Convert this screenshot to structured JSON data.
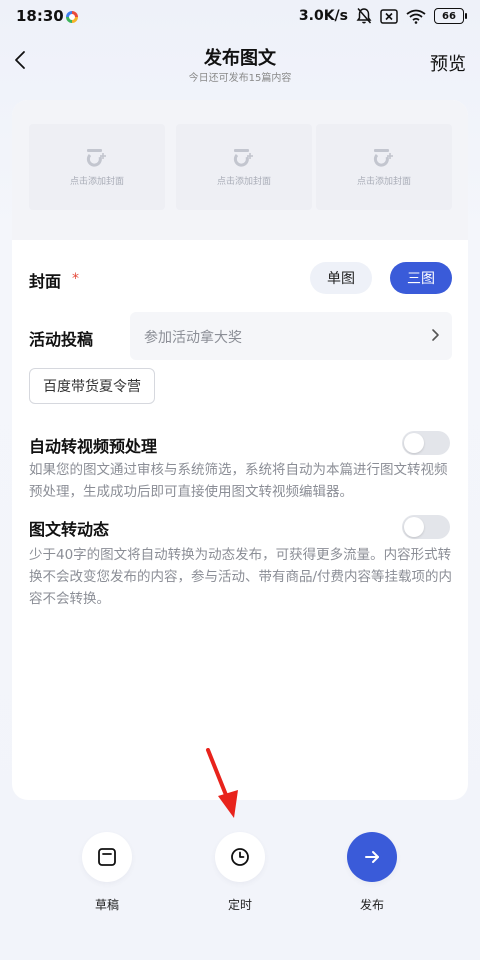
{
  "status_bar": {
    "time": "18:30",
    "network_speed": "3.0K/s",
    "battery": "66",
    "icons": [
      "app-notification-icon",
      "mute-bell-icon",
      "sim-x-icon",
      "wifi-icon",
      "battery-icon"
    ]
  },
  "header": {
    "title": "发布图文",
    "subtitle": "今日还可发布15篇内容",
    "preview_label": "预览"
  },
  "covers": {
    "slots": [
      {
        "label": "点击添加封面"
      },
      {
        "label": "点击添加封面"
      },
      {
        "label": "点击添加封面"
      }
    ]
  },
  "cover_row": {
    "label": "封面",
    "required_mark": "*",
    "options": [
      "单图",
      "三图"
    ],
    "selected": "三图"
  },
  "activity": {
    "label": "活动投稿",
    "placeholder": "参加活动拿大奖",
    "tag": "百度带货夏令营"
  },
  "auto_video": {
    "label": "自动转视频预处理",
    "enabled": false,
    "description": "如果您的图文通过审核与系统筛选，系统将自动为本篇进行图文转视频预处理，生成成功后即可直接使用图文转视频编辑器。"
  },
  "to_dynamic": {
    "label": "图文转动态",
    "enabled": false,
    "description": "少于40字的图文将自动转换为动态发布，可获得更多流量。内容形式转换不会改变您发布的内容，参与活动、带有商品/付费内容等挂载项的内容不会转换。"
  },
  "bottom_bar": {
    "draft_label": "草稿",
    "timer_label": "定时",
    "publish_label": "发布"
  },
  "colors": {
    "accent": "#3a5bd9",
    "required": "#e5493a",
    "annotation_arrow": "#e8231c"
  }
}
